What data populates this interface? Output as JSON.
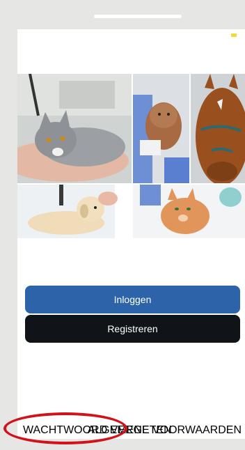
{
  "actions": {
    "login_label": "Inloggen",
    "register_label": "Registreren"
  },
  "footer": {
    "forgot_password": "WACHTWOORD VERGETEN",
    "terms": "ALGEMENE VOORWAARDEN"
  },
  "images": [
    {
      "subject": "cat"
    },
    {
      "subject": "puppy"
    },
    {
      "subject": "horse"
    },
    {
      "subject": "dog"
    },
    {
      "subject": "cat"
    }
  ],
  "colors": {
    "primary": "#2d63a8",
    "secondary": "#101418",
    "highlight": "#d2121a",
    "indicator": "#f5d63c"
  }
}
